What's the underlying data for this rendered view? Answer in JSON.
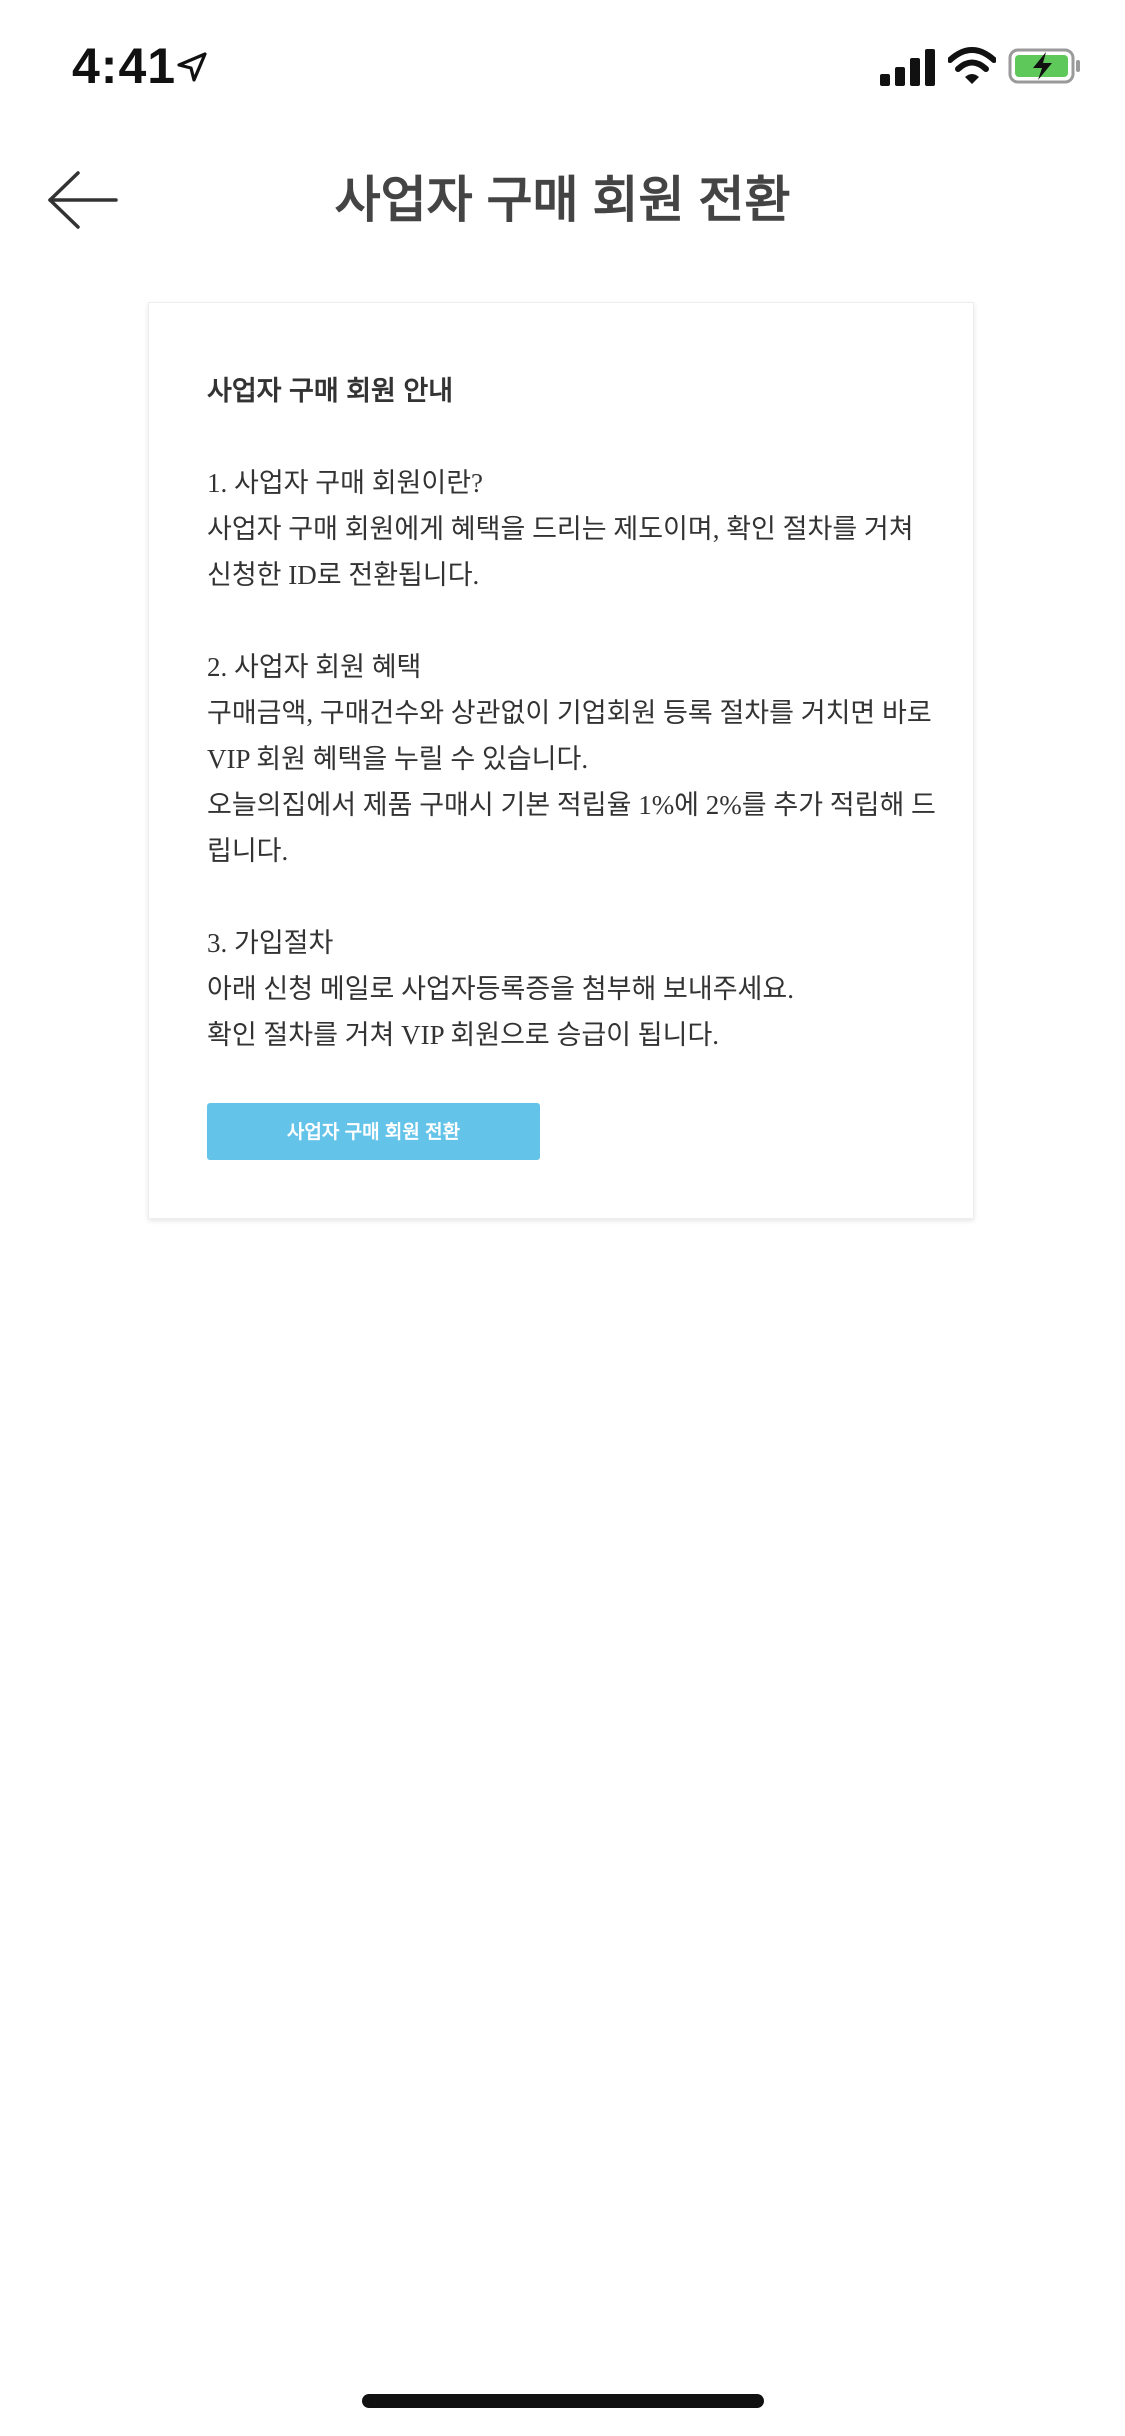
{
  "status_bar": {
    "time": "4:41",
    "icons": [
      "location-arrow-icon",
      "cellular-signal-icon",
      "wifi-icon",
      "battery-charging-icon"
    ],
    "battery_color": "#5ec95a"
  },
  "header": {
    "title": "사업자 구매 회원 전환",
    "back_icon": "arrow-left-icon"
  },
  "card": {
    "heading": "사업자 구매 회원 안내",
    "section1": {
      "title": "1. 사업자 구매 회원이란?",
      "lines": [
        "사업자 구매 회원에게 혜택을 드리는 제도이며, 확인 절차를 거쳐",
        "신청한 ID로 전환됩니다."
      ]
    },
    "section2": {
      "title": "2. 사업자 회원 혜택",
      "lines": [
        "구매금액, 구매건수와 상관없이 기업회원 등록 절차를 거치면 바로",
        "VIP 회원 혜택을 누릴 수 있습니다.",
        "오늘의집에서 제품 구매시 기본 적립율 1%에 2%를 추가 적립해 드",
        "립니다."
      ]
    },
    "section3": {
      "title": "3. 가입절차",
      "lines": [
        "아래 신청 메일로 사업자등록증을 첨부해 보내주세요.",
        "확인 절차를 거쳐 VIP 회원으로 승급이 됩니다."
      ]
    },
    "button_label": "사업자 구매 회원 전환",
    "button_color": "#64c3e8"
  }
}
